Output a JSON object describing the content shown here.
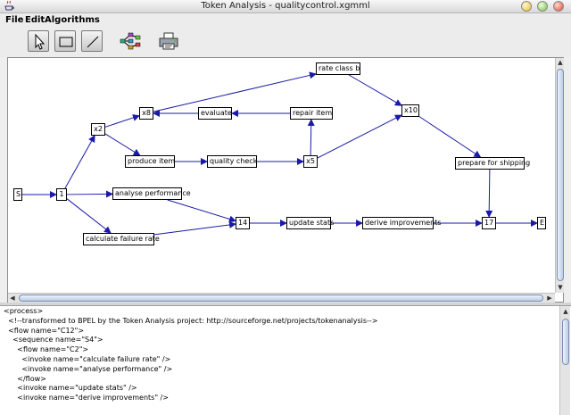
{
  "window": {
    "title": "Token Analysis - qualitycontrol.xgmml"
  },
  "menu": [
    {
      "id": "file",
      "label": "File"
    },
    {
      "id": "edit",
      "label": "Edit"
    },
    {
      "id": "algorithms",
      "label": "Algorithms"
    }
  ],
  "toolbar": [
    {
      "id": "select-tool",
      "icon": "pointer-arrow-icon"
    },
    {
      "id": "rectangle-tool",
      "icon": "rectangle-icon"
    },
    {
      "id": "line-tool",
      "icon": "line-icon"
    },
    {
      "id": "network-tool",
      "icon": "network-graph-icon"
    },
    {
      "id": "print-tool",
      "icon": "printer-icon"
    }
  ],
  "graph": {
    "edge_color": "#1a1aa8",
    "nodes": [
      {
        "id": "s",
        "label": "S"
      },
      {
        "id": "n1",
        "label": "1"
      },
      {
        "id": "x2",
        "label": "x2"
      },
      {
        "id": "x8",
        "label": "x8"
      },
      {
        "id": "evaluate",
        "label": "evaluate"
      },
      {
        "id": "repair",
        "label": "repair item"
      },
      {
        "id": "rate",
        "label": "rate class b"
      },
      {
        "id": "x10",
        "label": "x10"
      },
      {
        "id": "produce",
        "label": "produce item"
      },
      {
        "id": "quality",
        "label": "quality check"
      },
      {
        "id": "x5",
        "label": "x5"
      },
      {
        "id": "prepare",
        "label": "prepare for shipping"
      },
      {
        "id": "analyse",
        "label": "analyse performance"
      },
      {
        "id": "failure",
        "label": "calculate failure rate"
      },
      {
        "id": "n14",
        "label": "14"
      },
      {
        "id": "update",
        "label": "update stats"
      },
      {
        "id": "derive",
        "label": "derive improvements"
      },
      {
        "id": "n17",
        "label": "17"
      },
      {
        "id": "e",
        "label": "E"
      }
    ],
    "edges": [
      [
        "s",
        "n1"
      ],
      [
        "n1",
        "x2"
      ],
      [
        "n1",
        "analyse"
      ],
      [
        "n1",
        "failure"
      ],
      [
        "x2",
        "x8"
      ],
      [
        "x2",
        "produce"
      ],
      [
        "x8",
        "rate"
      ],
      [
        "evaluate",
        "x8"
      ],
      [
        "repair",
        "evaluate"
      ],
      [
        "rate",
        "x10"
      ],
      [
        "produce",
        "quality"
      ],
      [
        "quality",
        "x5"
      ],
      [
        "x5",
        "repair"
      ],
      [
        "x5",
        "x10"
      ],
      [
        "x10",
        "prepare"
      ],
      [
        "prepare",
        "n17"
      ],
      [
        "analyse",
        "n14"
      ],
      [
        "failure",
        "n14"
      ],
      [
        "n14",
        "update"
      ],
      [
        "update",
        "derive"
      ],
      [
        "derive",
        "n17"
      ],
      [
        "n17",
        "e"
      ]
    ]
  },
  "code": {
    "lines": [
      "<process>",
      "  <!--transformed to BPEL by the Token Analysis project: http://sourceforge.net/projects/tokenanalysis-->",
      "  <flow name=\"C12\">",
      "    <sequence name=\"S4\">",
      "      <flow name=\"C2\">",
      "        <invoke name=\"calculate failure rate\" />",
      "        <invoke name=\"analyse performance\" />",
      "      </flow>",
      "      <invoke name=\"update stats\" />",
      "      <invoke name=\"derive improvements\" />"
    ]
  }
}
